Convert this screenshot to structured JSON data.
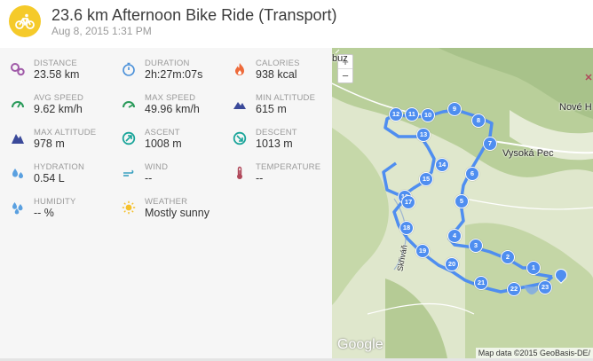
{
  "header": {
    "title": "23.6 km Afternoon Bike Ride (Transport)",
    "date": "Aug 8, 2015 1:31 PM",
    "icon": "bicycle-icon",
    "accent": "#f5ca2a"
  },
  "stats": [
    {
      "label": "DISTANCE",
      "value": "23.58 km",
      "icon": "distance-icon",
      "color": "#a05aa8"
    },
    {
      "label": "DURATION",
      "value": "2h:27m:07s",
      "icon": "stopwatch-icon",
      "color": "#4a90d9"
    },
    {
      "label": "CALORIES",
      "value": "938 kcal",
      "icon": "flame-icon",
      "color": "#ee6a3a"
    },
    {
      "label": "AVG SPEED",
      "value": "9.62 km/h",
      "icon": "speedometer-icon",
      "color": "#2a9a5a"
    },
    {
      "label": "MAX SPEED",
      "value": "49.96 km/h",
      "icon": "speedometer-icon",
      "color": "#2a9a5a"
    },
    {
      "label": "MIN ALTITUDE",
      "value": "615 m",
      "icon": "mountain-icon",
      "color": "#3b4a9a"
    },
    {
      "label": "MAX ALTITUDE",
      "value": "978 m",
      "icon": "mountain-icon",
      "color": "#3b4a9a"
    },
    {
      "label": "ASCENT",
      "value": "1008 m",
      "icon": "ascent-icon",
      "color": "#1aa59a"
    },
    {
      "label": "DESCENT",
      "value": "1013 m",
      "icon": "descent-icon",
      "color": "#1aa59a"
    },
    {
      "label": "HYDRATION",
      "value": "0.54 L",
      "icon": "droplets-icon",
      "color": "#5aa0e0"
    },
    {
      "label": "WIND",
      "value": "--",
      "icon": "wind-icon",
      "color": "#3aa0c0"
    },
    {
      "label": "TEMPERATURE",
      "value": "--",
      "icon": "thermometer-icon",
      "color": "#b0485a"
    },
    {
      "label": "HUMIDITY",
      "value": "-- %",
      "icon": "humidity-icon",
      "color": "#5aa0e0"
    },
    {
      "label": "WEATHER",
      "value": "Mostly sunny",
      "icon": "sun-icon",
      "color": "#f5c02a"
    }
  ],
  "map": {
    "zoom_in": "+",
    "zoom_out": "−",
    "places": [
      "Nové H",
      "Vysoká Pec",
      "Skřiváň",
      "buz"
    ],
    "attribution": "Map data ©2015 GeoBasis-DE/",
    "logo": "Google",
    "route_color": "#4f8ef0",
    "markers": [
      "1",
      "2",
      "3",
      "4",
      "5",
      "6",
      "7",
      "8",
      "9",
      "10",
      "11",
      "12",
      "13",
      "14",
      "15",
      "16",
      "17",
      "18",
      "19",
      "20",
      "21",
      "22",
      "23"
    ]
  }
}
